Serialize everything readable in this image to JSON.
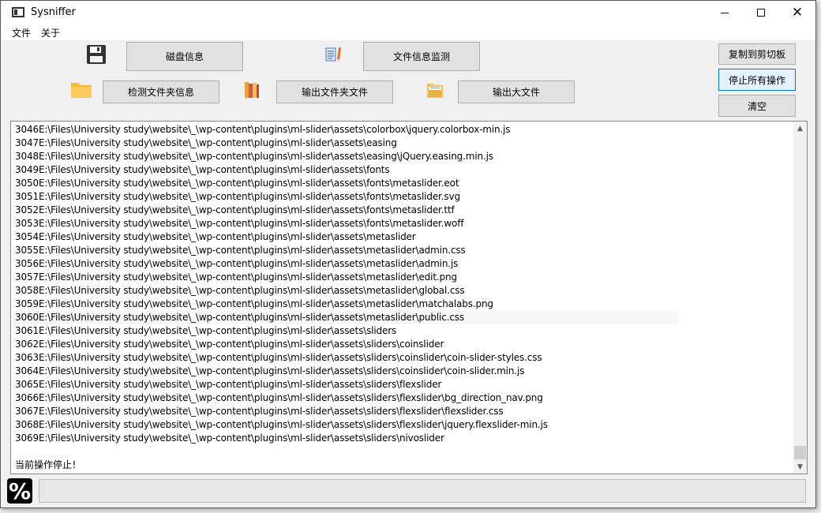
{
  "window": {
    "title": "Sysniffer"
  },
  "menu": {
    "file": "文件",
    "about": "关于"
  },
  "toolbar": {
    "disk_info": "磁盘信息",
    "file_monitor": "文件信息监测",
    "check_folder": "检测文件夹信息",
    "export_folder_files": "输出文件夹文件",
    "export_large_files": "输出大文件"
  },
  "actions": {
    "copy_clipboard": "复制到剪切板",
    "stop_all": "停止所有操作",
    "clear": "清空"
  },
  "log": {
    "lines": [
      "3046E:\\Files\\University study\\website\\_\\wp-content\\plugins\\ml-slider\\assets\\colorbox\\jquery.colorbox-min.js",
      "3047E:\\Files\\University study\\website\\_\\wp-content\\plugins\\ml-slider\\assets\\easing",
      "3048E:\\Files\\University study\\website\\_\\wp-content\\plugins\\ml-slider\\assets\\easing\\jQuery.easing.min.js",
      "3049E:\\Files\\University study\\website\\_\\wp-content\\plugins\\ml-slider\\assets\\fonts",
      "3050E:\\Files\\University study\\website\\_\\wp-content\\plugins\\ml-slider\\assets\\fonts\\metaslider.eot",
      "3051E:\\Files\\University study\\website\\_\\wp-content\\plugins\\ml-slider\\assets\\fonts\\metaslider.svg",
      "3052E:\\Files\\University study\\website\\_\\wp-content\\plugins\\ml-slider\\assets\\fonts\\metaslider.ttf",
      "3053E:\\Files\\University study\\website\\_\\wp-content\\plugins\\ml-slider\\assets\\fonts\\metaslider.woff",
      "3054E:\\Files\\University study\\website\\_\\wp-content\\plugins\\ml-slider\\assets\\metaslider",
      "3055E:\\Files\\University study\\website\\_\\wp-content\\plugins\\ml-slider\\assets\\metaslider\\admin.css",
      "3056E:\\Files\\University study\\website\\_\\wp-content\\plugins\\ml-slider\\assets\\metaslider\\admin.js",
      "3057E:\\Files\\University study\\website\\_\\wp-content\\plugins\\ml-slider\\assets\\metaslider\\edit.png",
      "3058E:\\Files\\University study\\website\\_\\wp-content\\plugins\\ml-slider\\assets\\metaslider\\global.css",
      "3059E:\\Files\\University study\\website\\_\\wp-content\\plugins\\ml-slider\\assets\\metaslider\\matchalabs.png",
      "3060E:\\Files\\University study\\website\\_\\wp-content\\plugins\\ml-slider\\assets\\metaslider\\public.css",
      "3061E:\\Files\\University study\\website\\_\\wp-content\\plugins\\ml-slider\\assets\\sliders",
      "3062E:\\Files\\University study\\website\\_\\wp-content\\plugins\\ml-slider\\assets\\sliders\\coinslider",
      "3063E:\\Files\\University study\\website\\_\\wp-content\\plugins\\ml-slider\\assets\\sliders\\coinslider\\coin-slider-styles.css",
      "3064E:\\Files\\University study\\website\\_\\wp-content\\plugins\\ml-slider\\assets\\sliders\\coinslider\\coin-slider.min.js",
      "3065E:\\Files\\University study\\website\\_\\wp-content\\plugins\\ml-slider\\assets\\sliders\\flexslider",
      "3066E:\\Files\\University study\\website\\_\\wp-content\\plugins\\ml-slider\\assets\\sliders\\flexslider\\bg_direction_nav.png",
      "3067E:\\Files\\University study\\website\\_\\wp-content\\plugins\\ml-slider\\assets\\sliders\\flexslider\\flexslider.css",
      "3068E:\\Files\\University study\\website\\_\\wp-content\\plugins\\ml-slider\\assets\\sliders\\flexslider\\jquery.flexslider-min.js",
      "3069E:\\Files\\University study\\website\\_\\wp-content\\plugins\\ml-slider\\assets\\sliders\\nivoslider"
    ],
    "status": "当前操作停止！"
  },
  "progress": {
    "icon_text": "%",
    "fraction": 0
  },
  "icons": {
    "floppy": "floppy-disk-icon",
    "document": "document-icon",
    "folder": "folder-icon",
    "books": "books-icon",
    "archive": "archive-folder-icon"
  },
  "colors": {
    "accent": "#0078d7",
    "progress": "#06b025"
  }
}
